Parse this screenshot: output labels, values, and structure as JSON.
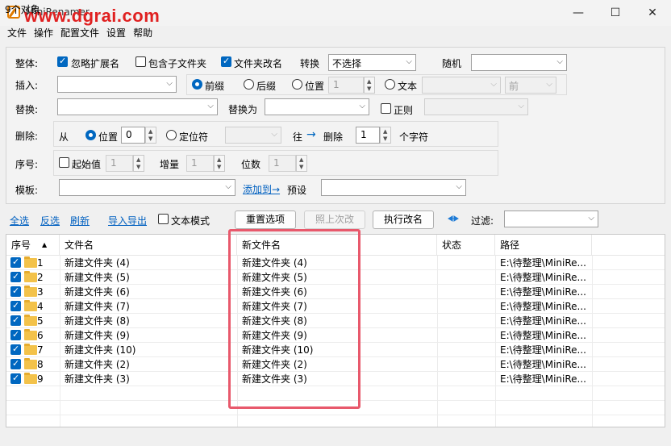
{
  "window": {
    "title": "MiniRenamer",
    "watermark": "www.dgrai.com",
    "minimize_glyph": "—",
    "maximize_glyph": "☐",
    "close_glyph": "✕"
  },
  "menu": [
    "文件",
    "操作",
    "配置文件",
    "设置",
    "帮助"
  ],
  "options": {
    "overall_label": "整体:",
    "ignore_ext_label": "忽略扩展名",
    "ignore_ext_checked": true,
    "include_sub_label": "包含子文件夹",
    "include_sub_checked": false,
    "rename_folder_label": "文件夹改名",
    "rename_folder_checked": true,
    "convert_label": "转换",
    "convert_value": "不选择",
    "random_label": "随机",
    "random_value": "",
    "insert_label": "插入:",
    "insert_value": "",
    "prefix_label": "前缀",
    "prefix_selected": true,
    "suffix_label": "后缀",
    "position_label": "位置",
    "insert_position_value": "1",
    "text_label": "文本",
    "text_value": "",
    "front_value": "前",
    "replace_label": "替换:",
    "replace_value": "",
    "replace_with_label": "替换为",
    "replace_with_value": "",
    "regex_label": "正则",
    "regex_checked": false,
    "regex_value": "",
    "delete_label": "删除:",
    "from_label": "从",
    "delete_position_label": "位置",
    "delete_position_value": "0",
    "locator_label": "定位符",
    "locator_value": "",
    "to_label": "往",
    "arrow_glyph": "→",
    "delete_word": "删除",
    "delete_count_value": "1",
    "chars_label": "个字符",
    "seq_label": "序号:",
    "start_label": "起始值",
    "start_checked": false,
    "start_value": "1",
    "increment_label": "增量",
    "increment_value": "1",
    "digits_label": "位数",
    "digits_value": "1",
    "template_label": "模板:",
    "template_value": "",
    "add_to_label": "添加到→",
    "preset_label": "预设",
    "preset_value": ""
  },
  "toolbar": {
    "select_all": "全选",
    "invert": "反选",
    "refresh": "刷新",
    "import_export": "导入导出",
    "text_mode_label": "文本模式",
    "text_mode_checked": false,
    "reset": "重置选项",
    "last_time": "照上次改",
    "execute": "执行改名",
    "filter_label": "过滤:",
    "filter_value": ""
  },
  "table": {
    "columns": [
      "序号",
      "文件名",
      "新文件名",
      "状态",
      "路径"
    ],
    "sort_glyph": "▲",
    "rows": [
      {
        "seq": "1",
        "name": "新建文件夹 (4)",
        "new_name": "新建文件夹 (4)",
        "status": "",
        "path": "E:\\待整理\\MiniRe..."
      },
      {
        "seq": "2",
        "name": "新建文件夹 (5)",
        "new_name": "新建文件夹 (5)",
        "status": "",
        "path": "E:\\待整理\\MiniRe..."
      },
      {
        "seq": "3",
        "name": "新建文件夹 (6)",
        "new_name": "新建文件夹 (6)",
        "status": "",
        "path": "E:\\待整理\\MiniRe..."
      },
      {
        "seq": "4",
        "name": "新建文件夹 (7)",
        "new_name": "新建文件夹 (7)",
        "status": "",
        "path": "E:\\待整理\\MiniRe..."
      },
      {
        "seq": "5",
        "name": "新建文件夹 (8)",
        "new_name": "新建文件夹 (8)",
        "status": "",
        "path": "E:\\待整理\\MiniRe..."
      },
      {
        "seq": "6",
        "name": "新建文件夹 (9)",
        "new_name": "新建文件夹 (9)",
        "status": "",
        "path": "E:\\待整理\\MiniRe..."
      },
      {
        "seq": "7",
        "name": "新建文件夹 (10)",
        "new_name": "新建文件夹 (10)",
        "status": "",
        "path": "E:\\待整理\\MiniRe..."
      },
      {
        "seq": "8",
        "name": "新建文件夹 (2)",
        "new_name": "新建文件夹 (2)",
        "status": "",
        "path": "E:\\待整理\\MiniRe..."
      },
      {
        "seq": "9",
        "name": "新建文件夹 (3)",
        "new_name": "新建文件夹 (3)",
        "status": "",
        "path": "E:\\待整理\\MiniRe..."
      }
    ]
  },
  "status": {
    "text": "9个对象"
  },
  "colors": {
    "accent": "#0067c0",
    "highlight": "#e8596c",
    "watermark": "#e02020",
    "link": "#0060c0"
  }
}
